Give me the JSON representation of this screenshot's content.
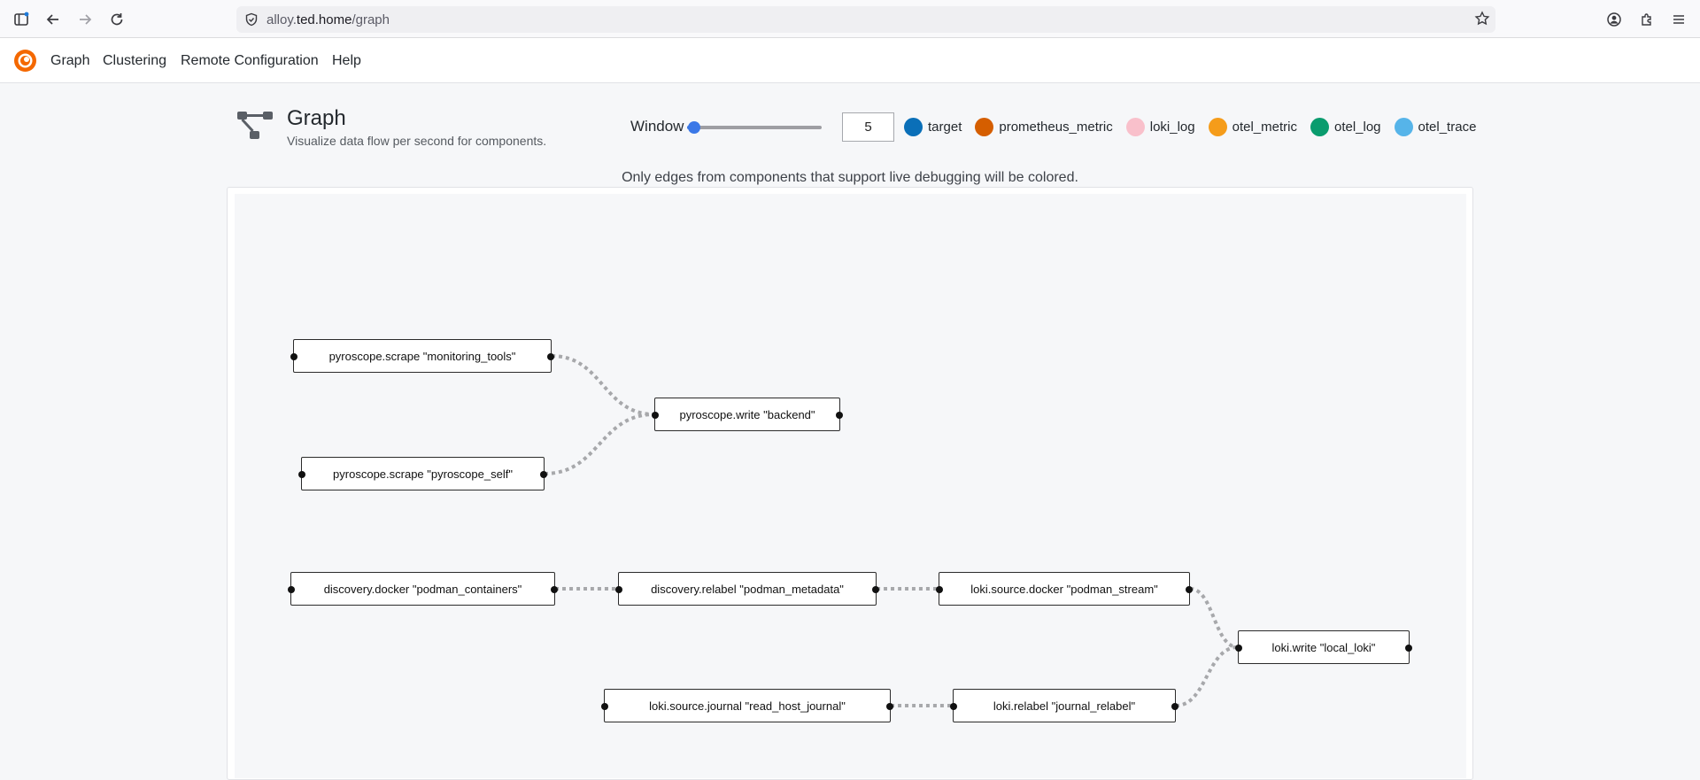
{
  "browser": {
    "url_domain": "alloy.",
    "url_host": "ted.home",
    "url_path": "/graph"
  },
  "nav": {
    "items": [
      "Graph",
      "Clustering",
      "Remote Configuration",
      "Help"
    ]
  },
  "header": {
    "title": "Graph",
    "subtitle": "Visualize data flow per second for components.",
    "window_label": "Window",
    "window_value": "5",
    "window_slider_fraction": 0.05
  },
  "legend": [
    {
      "label": "target",
      "color": "#0a6fb8"
    },
    {
      "label": "prometheus_metric",
      "color": "#d55e00"
    },
    {
      "label": "loki_log",
      "color": "#f9c0cb"
    },
    {
      "label": "otel_metric",
      "color": "#f59c1a"
    },
    {
      "label": "otel_log",
      "color": "#0a9c6e"
    },
    {
      "label": "otel_trace",
      "color": "#56b4e9"
    }
  ],
  "note": "Only edges from components that support live debugging will be colored.",
  "graph": {
    "nodes": [
      {
        "id": "n1",
        "label": "pyroscope.scrape \"monitoring_tools\""
      },
      {
        "id": "n2",
        "label": "pyroscope.scrape \"pyroscope_self\""
      },
      {
        "id": "n3",
        "label": "pyroscope.write \"backend\""
      },
      {
        "id": "n4",
        "label": "discovery.docker \"podman_containers\""
      },
      {
        "id": "n5",
        "label": "discovery.relabel \"podman_metadata\""
      },
      {
        "id": "n6",
        "label": "loki.source.docker \"podman_stream\""
      },
      {
        "id": "n7",
        "label": "loki.write \"local_loki\""
      },
      {
        "id": "n8",
        "label": "loki.source.journal \"read_host_journal\""
      },
      {
        "id": "n9",
        "label": "loki.relabel \"journal_relabel\""
      }
    ],
    "edges": [
      {
        "from": "n1",
        "to": "n3"
      },
      {
        "from": "n2",
        "to": "n3"
      },
      {
        "from": "n4",
        "to": "n5"
      },
      {
        "from": "n5",
        "to": "n6"
      },
      {
        "from": "n6",
        "to": "n7"
      },
      {
        "from": "n8",
        "to": "n9"
      },
      {
        "from": "n9",
        "to": "n7"
      }
    ],
    "edge_color": "#a7a8ab"
  }
}
